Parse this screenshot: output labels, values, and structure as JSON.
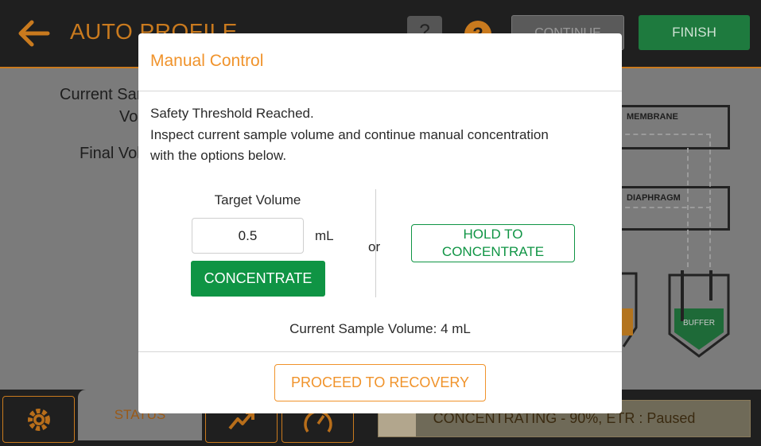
{
  "header": {
    "title": "AUTO PROFILE",
    "help_label": "?",
    "info_label": "?",
    "continue_label": "CONTINUE",
    "finish_label": "FINISH"
  },
  "background": {
    "current_sample_label": "Current Sample",
    "volume_label": "Volume:",
    "final_volume_label": "Final Volume:",
    "membrane_label": "MEMBRANE",
    "diaphragm_label": "DIAPHRAGM",
    "buffer_label": "BUFFER"
  },
  "bottom_bar": {
    "status_tab_label": "STATUS",
    "status_text": "CONCENTRATING - 90%, ETR : Paused",
    "progress_fraction": 0.9
  },
  "modal": {
    "title": "Manual Control",
    "message_line1": "Safety Threshold Reached.",
    "message_line2": "Inspect current sample volume and continue manual concentration",
    "message_line3": "with the options below.",
    "target_volume_label": "Target Volume",
    "target_volume_value": "0.5",
    "unit": "mL",
    "concentrate_label": "CONCENTRATE",
    "or_label": "or",
    "hold_line1": "HOLD TO",
    "hold_line2": "CONCENTRATE",
    "current_sample_volume": "Current Sample Volume: 4 mL",
    "proceed_label": "PROCEED TO RECOVERY"
  },
  "colors": {
    "accent_orange": "#f0932b",
    "green": "#0f9444",
    "topbar": "#1f1f1f"
  },
  "icons": [
    "back-arrow-icon",
    "help-icon",
    "info-icon",
    "gear-icon",
    "chart-icon",
    "gauge-icon"
  ]
}
